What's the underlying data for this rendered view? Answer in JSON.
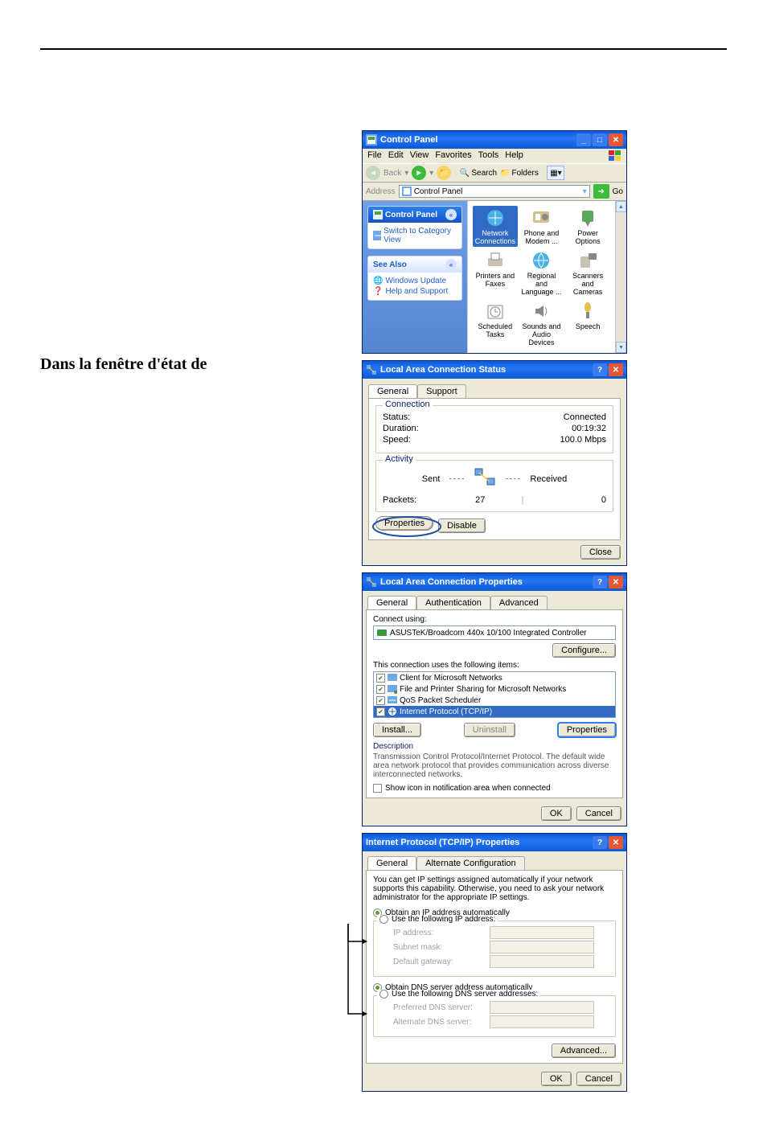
{
  "doc": {
    "left_text": "Dans la fenêtre d'état de"
  },
  "control_panel": {
    "title": "Control Panel",
    "menu": [
      "File",
      "Edit",
      "View",
      "Favorites",
      "Tools",
      "Help"
    ],
    "toolbar": {
      "back": "Back",
      "search": "Search",
      "folders": "Folders"
    },
    "address_label": "Address",
    "address_value": "Control Panel",
    "go": "Go",
    "sidebar": {
      "head": "Control Panel",
      "switch_link": "Switch to Category View",
      "see_also": "See Also",
      "links": [
        "Windows Update",
        "Help and Support"
      ]
    },
    "items": [
      {
        "label": "Network Connections",
        "selected": true
      },
      {
        "label": "Phone and Modem ..."
      },
      {
        "label": "Power Options"
      },
      {
        "label": "Printers and Faxes"
      },
      {
        "label": "Regional and Language ..."
      },
      {
        "label": "Scanners and Cameras"
      },
      {
        "label": "Scheduled Tasks"
      },
      {
        "label": "Sounds and Audio Devices"
      },
      {
        "label": "Speech"
      }
    ]
  },
  "status": {
    "title": "Local Area Connection Status",
    "tabs": [
      "General",
      "Support"
    ],
    "connection": {
      "heading": "Connection",
      "rows": [
        {
          "label": "Status:",
          "value": "Connected"
        },
        {
          "label": "Duration:",
          "value": "00:19:32"
        },
        {
          "label": "Speed:",
          "value": "100.0 Mbps"
        }
      ]
    },
    "activity": {
      "heading": "Activity",
      "sent": "Sent",
      "received": "Received",
      "packets_label": "Packets:",
      "packets_sent": "27",
      "packets_received": "0"
    },
    "buttons": {
      "properties": "Properties",
      "disable": "Disable",
      "close": "Close"
    }
  },
  "properties": {
    "title": "Local Area Connection Properties",
    "tabs": [
      "General",
      "Authentication",
      "Advanced"
    ],
    "connect_using": "Connect using:",
    "adapter": "ASUSTeK/Broadcom 440x 10/100 Integrated Controller",
    "configure": "Configure...",
    "items_heading": "This connection uses the following items:",
    "items": [
      {
        "label": "Client for Microsoft Networks",
        "selected": false,
        "checked": true
      },
      {
        "label": "File and Printer Sharing for Microsoft Networks",
        "selected": false,
        "checked": true
      },
      {
        "label": "QoS Packet Scheduler",
        "selected": false,
        "checked": true
      },
      {
        "label": "Internet Protocol (TCP/IP)",
        "selected": true,
        "checked": true
      }
    ],
    "install": "Install...",
    "uninstall": "Uninstall",
    "item_props": "Properties",
    "description_label": "Description",
    "description": "Transmission Control Protocol/Internet Protocol. The default wide area network protocol that provides communication across diverse interconnected networks.",
    "show_icon": "Show icon in notification area when connected",
    "ok": "OK",
    "cancel": "Cancel"
  },
  "tcpip": {
    "title": "Internet Protocol (TCP/IP) Properties",
    "tabs": [
      "General",
      "Alternate Configuration"
    ],
    "blurb": "You can get IP settings assigned automatically if your network supports this capability. Otherwise, you need to ask your network administrator for the appropriate IP settings.",
    "ip": {
      "auto": "Obtain an IP address automatically",
      "manual": "Use the following IP address:",
      "fields": [
        "IP address:",
        "Subnet mask:",
        "Default gateway:"
      ]
    },
    "dns": {
      "auto": "Obtain DNS server address automatically",
      "manual": "Use the following DNS server addresses:",
      "fields": [
        "Preferred DNS server:",
        "Alternate DNS server:"
      ]
    },
    "advanced": "Advanced...",
    "ok": "OK",
    "cancel": "Cancel"
  }
}
